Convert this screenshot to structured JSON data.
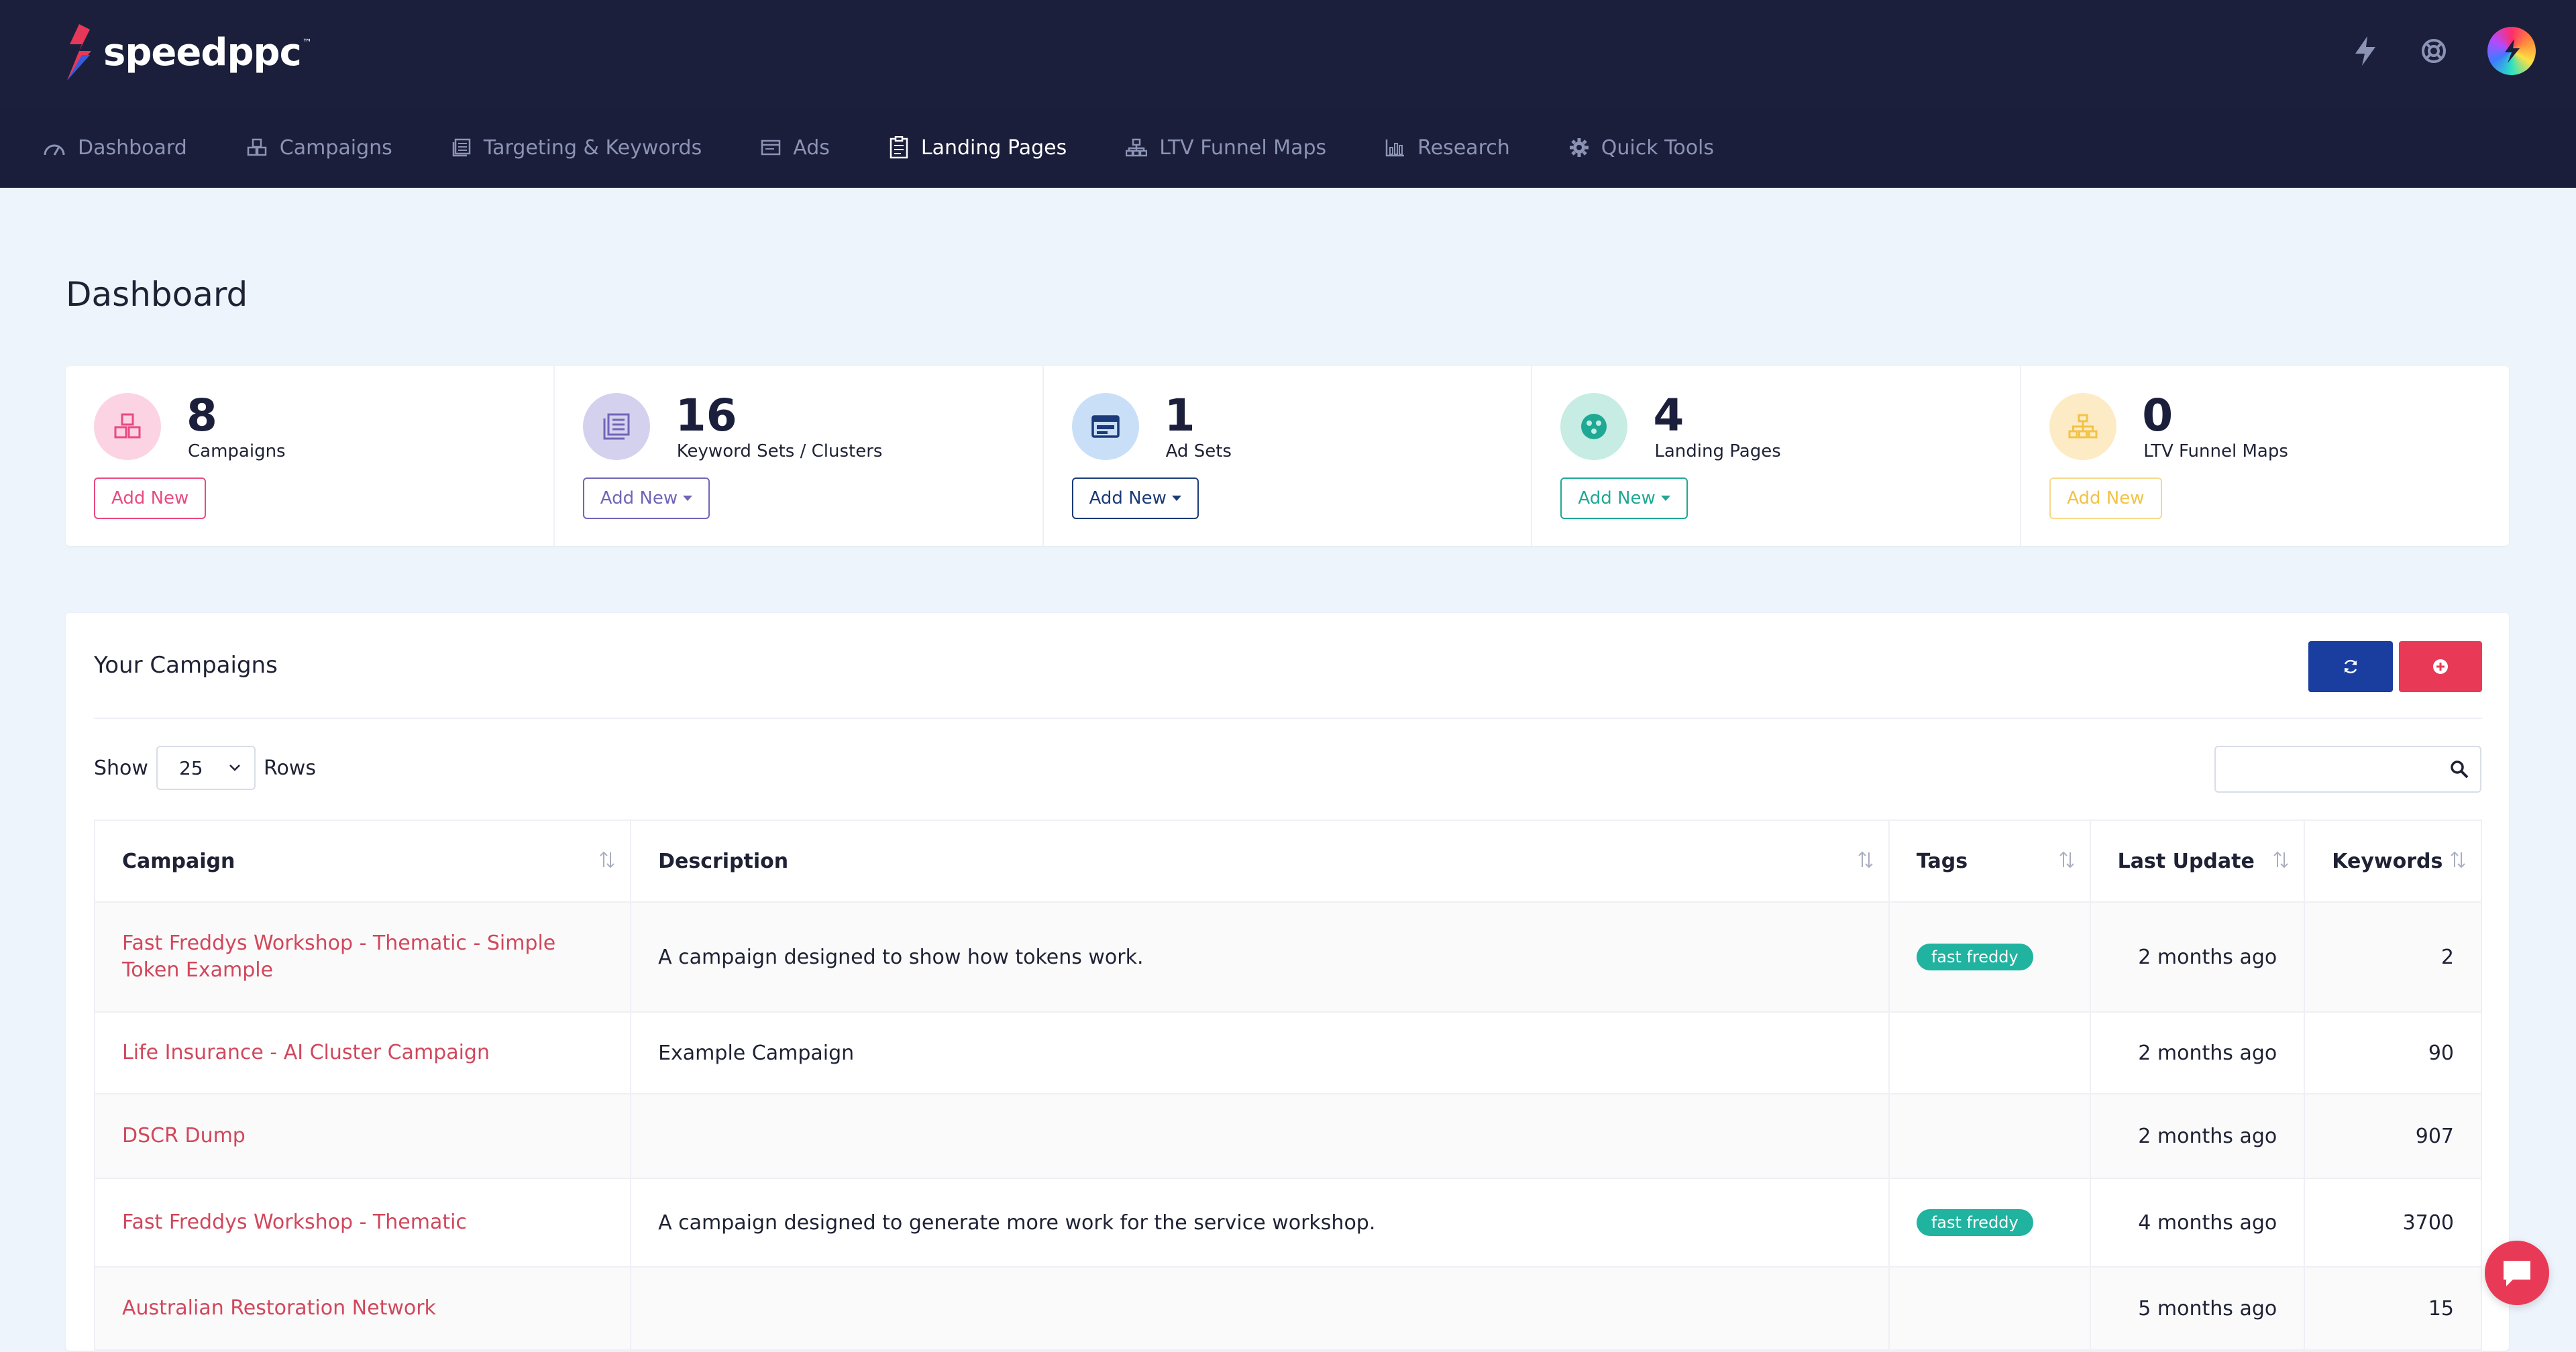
{
  "brand": {
    "name": "speedppc",
    "tm": "™"
  },
  "nav": [
    {
      "label": "Dashboard",
      "icon": "gauge-icon"
    },
    {
      "label": "Campaigns",
      "icon": "cubes-icon"
    },
    {
      "label": "Targeting & Keywords",
      "icon": "list-icon"
    },
    {
      "label": "Ads",
      "icon": "window-icon"
    },
    {
      "label": "Landing Pages",
      "icon": "clipboard-icon",
      "active": true
    },
    {
      "label": "LTV Funnel Maps",
      "icon": "sitemap-icon"
    },
    {
      "label": "Research",
      "icon": "bar-chart-icon"
    },
    {
      "label": "Quick Tools",
      "icon": "gear-icon"
    }
  ],
  "page": {
    "title": "Dashboard"
  },
  "stats": [
    {
      "value": "8",
      "label": "Campaigns",
      "button": "Add New",
      "color": "#e94b7f",
      "bg": "#fcd3e3"
    },
    {
      "value": "16",
      "label": "Keyword Sets / Clusters",
      "button": "Add New",
      "color": "#6f66b8",
      "bg": "#d4d1ef"
    },
    {
      "value": "1",
      "label": "Ad Sets",
      "button": "Add New",
      "color": "#1b3a78",
      "bg": "#c9dff8"
    },
    {
      "value": "4",
      "label": "Landing Pages",
      "button": "Add New",
      "color": "#1fa894",
      "bg": "#c6ece3"
    },
    {
      "value": "0",
      "label": "LTV Funnel Maps",
      "button": "Add New",
      "color": "#f3c245",
      "bg": "#fdebc5"
    }
  ],
  "campaigns_card": {
    "title": "Your Campaigns",
    "show_label": "Show",
    "rows_value": "25",
    "rows_label": "Rows",
    "search_placeholder": ""
  },
  "table": {
    "columns": [
      "Campaign",
      "Description",
      "Tags",
      "Last Update",
      "Keywords"
    ],
    "rows": [
      {
        "campaign": "Fast Freddys Workshop - Thematic - Simple Token Example",
        "description": "A campaign designed to show how tokens work.",
        "tag": "fast freddy",
        "updated": "2 months ago",
        "keywords": "2"
      },
      {
        "campaign": "Life Insurance - AI Cluster Campaign",
        "description": "Example Campaign",
        "tag": "",
        "updated": "2 months ago",
        "keywords": "90"
      },
      {
        "campaign": "DSCR Dump",
        "description": "",
        "tag": "",
        "updated": "2 months ago",
        "keywords": "907"
      },
      {
        "campaign": "Fast Freddys Workshop - Thematic",
        "description": "A campaign designed to generate more work for the service workshop.",
        "tag": "fast freddy",
        "updated": "4 months ago",
        "keywords": "3700"
      },
      {
        "campaign": "Australian Restoration Network",
        "description": "",
        "tag": "",
        "updated": "5 months ago",
        "keywords": "15"
      }
    ]
  },
  "colors": {
    "header_bg": "#1b1f3b",
    "accent_link": "#d1475c",
    "primary": "#1a3ea0",
    "danger": "#e83a56",
    "tag": "#20b3a0"
  }
}
